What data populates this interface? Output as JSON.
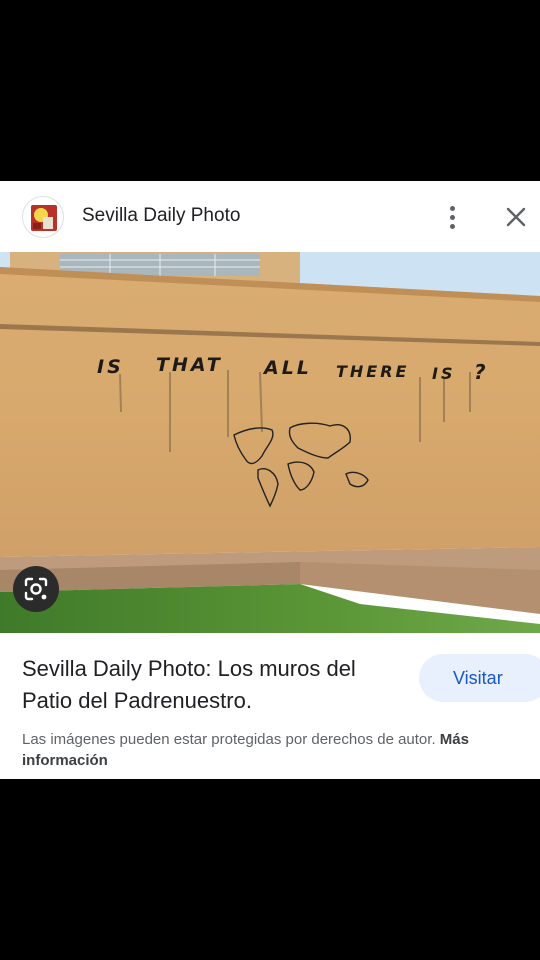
{
  "header": {
    "site_name": "Sevilla Daily Photo",
    "more_icon": "more-vert-icon",
    "close_icon": "close-icon"
  },
  "photo": {
    "wall_text": [
      "IS",
      "THAT",
      "ALL",
      "THERE",
      "IS",
      "?"
    ]
  },
  "lens_icon": "google-lens-icon",
  "result": {
    "title": "Sevilla Daily Photo: Los muros del Patio del Padrenuestro.",
    "visit_label": "Visitar",
    "copyright_text": "Las imágenes pueden estar protegidas por derechos de autor.",
    "more_info_label": "Más información"
  },
  "colors": {
    "background": "#000000",
    "card": "#ffffff",
    "visit_button_bg": "#e8f0fe",
    "visit_button_text": "#1a56c8",
    "wall": "#d6a86e",
    "grass": "#4e8a2e",
    "sky": "#cfe3f2"
  }
}
